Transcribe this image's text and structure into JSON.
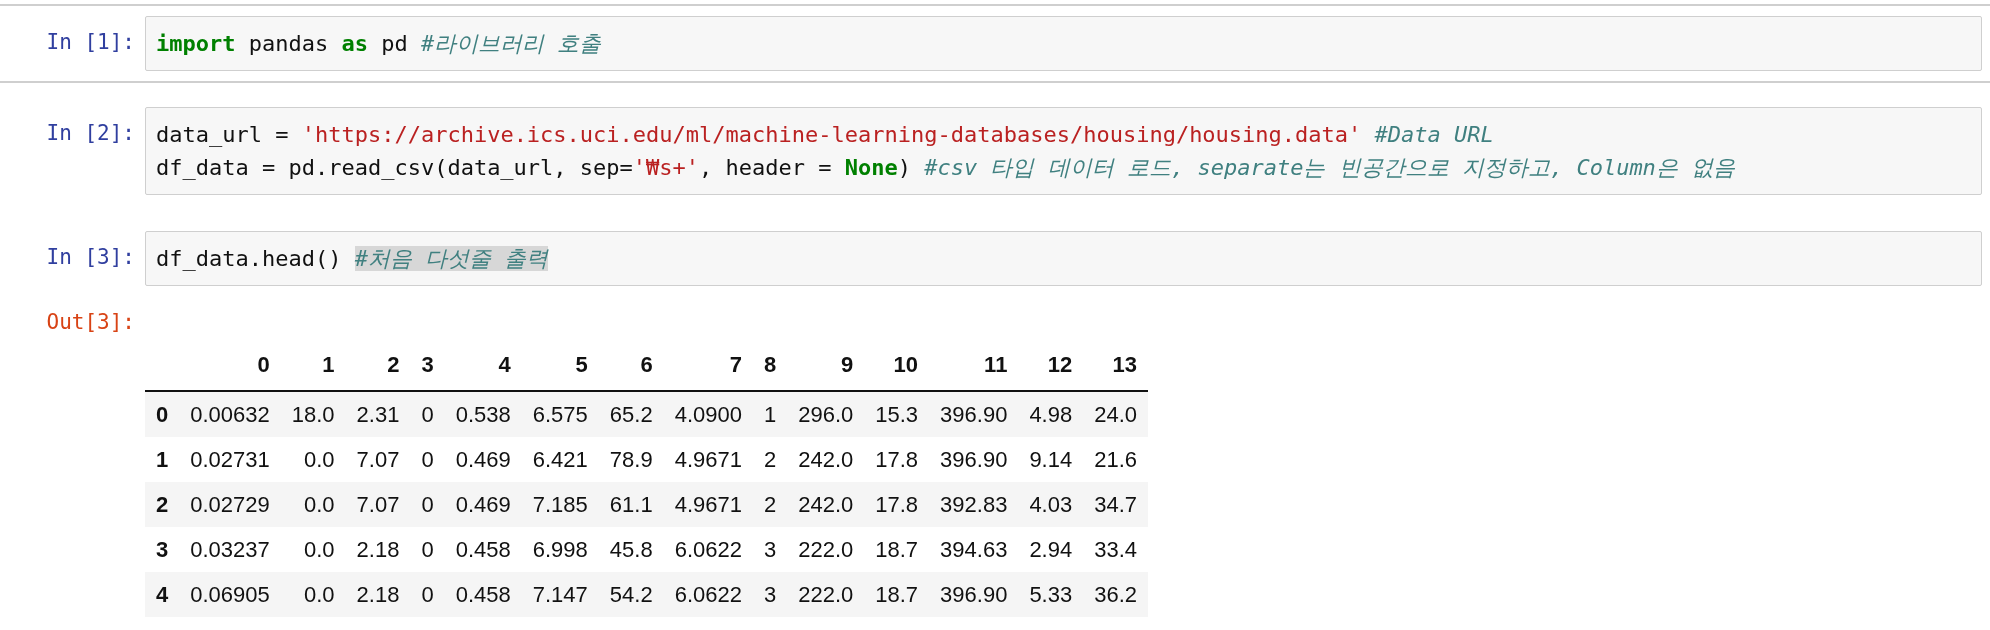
{
  "cells": [
    {
      "prompt": "In [1]:",
      "selected": true,
      "lines": [
        [
          {
            "kind": "kw",
            "text": "import"
          },
          {
            "kind": "text",
            "text": " pandas "
          },
          {
            "kind": "kw",
            "text": "as"
          },
          {
            "kind": "text",
            "text": " pd "
          },
          {
            "kind": "comment",
            "text": "#라이브러리 호출"
          }
        ]
      ]
    },
    {
      "prompt": "In [2]:",
      "selected": false,
      "lines": [
        [
          {
            "kind": "text",
            "text": "data_url = "
          },
          {
            "kind": "str",
            "text": "'https://archive.ics.uci.edu/ml/machine-learning-databases/housing/housing.data'"
          },
          {
            "kind": "comment",
            "text": " #Data URL"
          }
        ],
        [
          {
            "kind": "text",
            "text": "df_data = pd.read_csv(data_url, sep="
          },
          {
            "kind": "str",
            "text": "'₩s+'"
          },
          {
            "kind": "text",
            "text": ", header = "
          },
          {
            "kind": "kw",
            "text": "None"
          },
          {
            "kind": "text",
            "text": ") "
          },
          {
            "kind": "comment",
            "text": "#csv 타입 데이터 로드, separate는 빈공간으로 지정하고, Column은 없음"
          }
        ]
      ]
    },
    {
      "prompt": "In [3]:",
      "selected": false,
      "lines": [
        [
          {
            "kind": "text",
            "text": "df_data.head() "
          },
          {
            "kind": "comment-highlighted",
            "text": "#처음 다섯줄 출력"
          }
        ]
      ]
    }
  ],
  "output": {
    "prompt": "Out[3]:",
    "table": {
      "columns": [
        "0",
        "1",
        "2",
        "3",
        "4",
        "5",
        "6",
        "7",
        "8",
        "9",
        "10",
        "11",
        "12",
        "13"
      ],
      "rows": [
        {
          "index": "0",
          "cells": [
            "0.00632",
            "18.0",
            "2.31",
            "0",
            "0.538",
            "6.575",
            "65.2",
            "4.0900",
            "1",
            "296.0",
            "15.3",
            "396.90",
            "4.98",
            "24.0"
          ]
        },
        {
          "index": "1",
          "cells": [
            "0.02731",
            "0.0",
            "7.07",
            "0",
            "0.469",
            "6.421",
            "78.9",
            "4.9671",
            "2",
            "242.0",
            "17.8",
            "396.90",
            "9.14",
            "21.6"
          ]
        },
        {
          "index": "2",
          "cells": [
            "0.02729",
            "0.0",
            "7.07",
            "0",
            "0.469",
            "7.185",
            "61.1",
            "4.9671",
            "2",
            "242.0",
            "17.8",
            "392.83",
            "4.03",
            "34.7"
          ]
        },
        {
          "index": "3",
          "cells": [
            "0.03237",
            "0.0",
            "2.18",
            "0",
            "0.458",
            "6.998",
            "45.8",
            "6.0622",
            "3",
            "222.0",
            "18.7",
            "394.63",
            "2.94",
            "33.4"
          ]
        },
        {
          "index": "4",
          "cells": [
            "0.06905",
            "0.0",
            "2.18",
            "0",
            "0.458",
            "7.147",
            "54.2",
            "6.0622",
            "3",
            "222.0",
            "18.7",
            "396.90",
            "5.33",
            "36.2"
          ]
        }
      ]
    }
  }
}
